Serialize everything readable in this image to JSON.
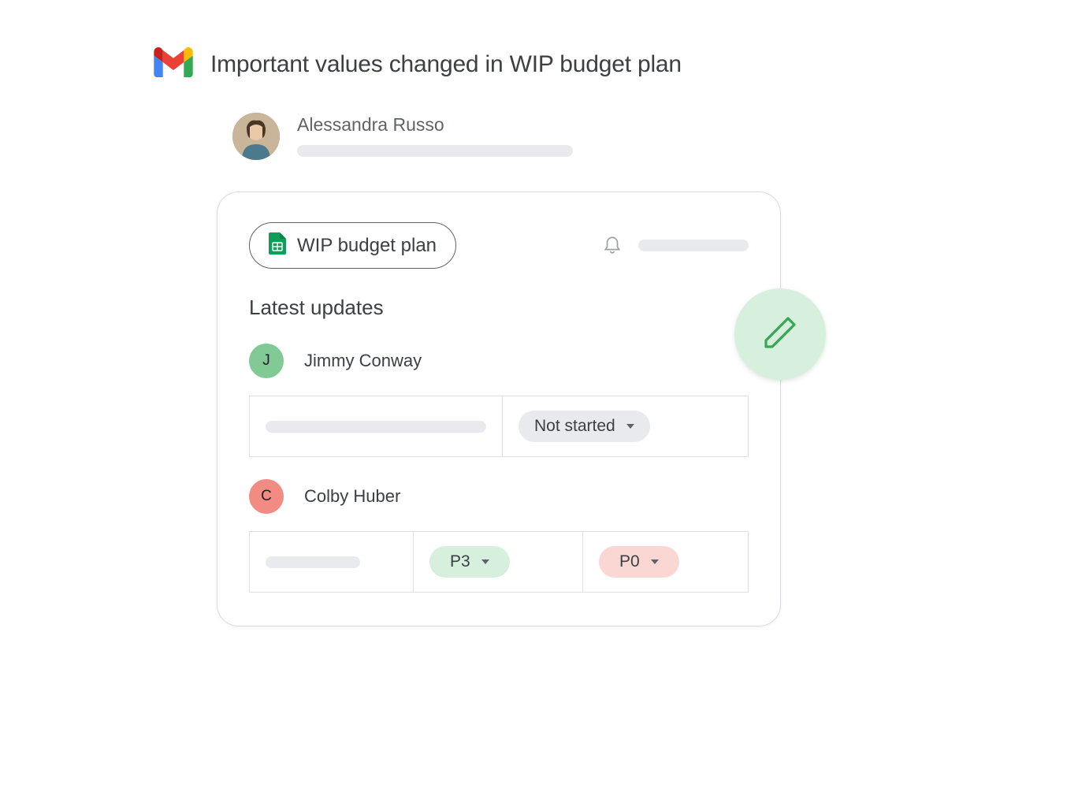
{
  "email": {
    "subject": "Important values changed in WIP budget plan",
    "sender_name": "Alessandra Russo"
  },
  "card": {
    "file_name": "WIP budget plan",
    "section_title": "Latest updates",
    "updates": [
      {
        "avatar_letter": "J",
        "avatar_color": "green",
        "person_name": "Jimmy Conway",
        "status_label": "Not started"
      },
      {
        "avatar_letter": "C",
        "avatar_color": "red",
        "person_name": "Colby Huber",
        "pill_a": "P3",
        "pill_b": "P0"
      }
    ]
  }
}
